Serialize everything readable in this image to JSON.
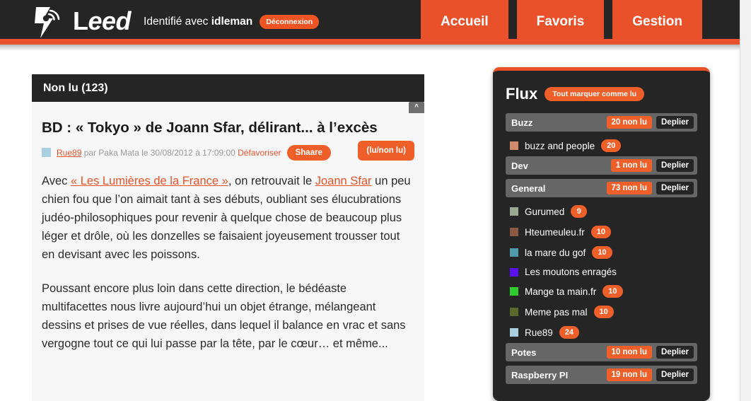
{
  "header": {
    "logo_icon": "rss-bolt-logo-icon",
    "brand_cap": "L",
    "brand_rest": "eed",
    "ident_prefix": "Identifié avec ",
    "ident_user": "idleman",
    "logout_label": "Déconnexion",
    "accent_color": "#e8512a",
    "dark_color": "#252525",
    "nav": [
      {
        "label": "Accueil",
        "name": "nav-accueil"
      },
      {
        "label": "Favoris",
        "name": "nav-favoris"
      },
      {
        "label": "Gestion",
        "name": "nav-gestion"
      }
    ]
  },
  "article_panel": {
    "unread_header": "Non lu (123)",
    "collapse_label": "^",
    "title": "BD : « Tokyo » de Joann Sfar, délirant... à l’excès",
    "source_swatch_color": "#a9cfe0",
    "byline": {
      "source": "Rue89",
      "middle": " par Paka Mata le 30/08/2012 à 17:09:00 ",
      "defavoriser": "Défavoriser",
      "shaare_label": "Shaare"
    },
    "lu_non_lu_label": "(lu/non lu)",
    "paragraphs": [
      {
        "parts": [
          {
            "t": "Avec ",
            "link": false
          },
          {
            "t": "« Les Lumières de la France »",
            "link": true
          },
          {
            "t": ", on retrouvait le ",
            "link": false
          },
          {
            "t": "Joann Sfar",
            "link": true
          },
          {
            "t": " un peu chien fou que l’on aimait tant à ses débuts, oubliant ses élucubrations judéo-philosophiques pour revenir à quelque chose de beaucoup plus léger et drôle, où les donzelles se faisaient joyeusement trousser tout en devisant avec les poissons.",
            "link": false
          }
        ]
      },
      {
        "parts": [
          {
            "t": "Poussant encore plus loin dans cette direction, le bédéaste multifacettes nous livre aujourd’hui un objet étrange, mélangeant dessins et prises de vue réelles, dans lequel il balance en vrac et sans vergogne tout ce qui lui passe par la tête, par le cœur… et même...",
            "link": false
          }
        ]
      }
    ]
  },
  "sidebar": {
    "title": "Flux",
    "mark_all_label": "Tout marquer comme lu",
    "expand_label": "Deplier",
    "groups": [
      {
        "type": "category",
        "name": "Buzz",
        "count_label": "20 non lu",
        "feeds": [
          {
            "name": "buzz and people",
            "count": "20",
            "color": "#d08b6e"
          }
        ]
      },
      {
        "type": "category",
        "name": "Dev",
        "count_label": "1 non lu",
        "feeds": []
      },
      {
        "type": "category",
        "name": "General",
        "count_label": "73 non lu",
        "feeds": [
          {
            "name": "Gurumed",
            "count": "9",
            "color": "#9aa894"
          },
          {
            "name": "Hteumeuleu.fr",
            "count": "10",
            "color": "#8a5a45"
          },
          {
            "name": "la mare du gof",
            "count": "10",
            "color": "#4e9aa8"
          },
          {
            "name": "Les moutons enragés",
            "count": "",
            "color": "#5b10f0"
          },
          {
            "name": "Mange ta main.fr",
            "count": "10",
            "color": "#2ecc2e"
          },
          {
            "name": "Meme pas mal",
            "count": "10",
            "color": "#5a6a2e"
          },
          {
            "name": "Rue89",
            "count": "24",
            "color": "#a9cfe0"
          }
        ]
      },
      {
        "type": "category",
        "name": "Potes",
        "count_label": "10 non lu",
        "feeds": []
      },
      {
        "type": "category",
        "name": "Raspberry PI",
        "count_label": "19 non lu",
        "feeds": []
      }
    ]
  },
  "scrollbar": {
    "name": "page-scrollbar"
  }
}
